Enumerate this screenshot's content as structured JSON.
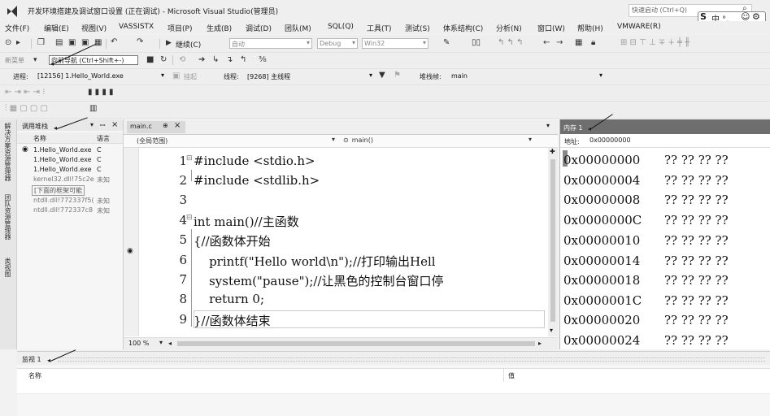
{
  "window": {
    "title": "开发环境搭建及调试窗口设置 (正在调试) - Microsoft Visual Studio(管理员)",
    "quick_launch": "快速启动 (Ctrl+Q)",
    "ime": "中 °,"
  },
  "menu": [
    "文件(F)",
    "编辑(E)",
    "视图(V)",
    "VASSISTX",
    "项目(P)",
    "生成(B)",
    "调试(D)",
    "团队(M)",
    "SQL(Q)",
    "工具(T)",
    "测试(S)",
    "体系结构(C)",
    "分析(N)",
    "窗口(W)",
    "帮助(H)",
    "VMWARE(R)"
  ],
  "toolbar1": {
    "continue_label": "继续(C)",
    "auto_combo": "自动",
    "config_combo": "Debug",
    "platform_combo": "Win32"
  },
  "toolbar2": {
    "new_menu": "新菜单",
    "tooltip": "向前导航 (Ctrl+Shift+-)"
  },
  "toolbar3": {
    "process_label": "进程:",
    "process_value": "[12156] 1.Hello_World.exe",
    "suspend_label": "挂起",
    "thread_label": "线程:",
    "thread_value": "[9268] 主线程",
    "stack_label": "堆栈帧:",
    "stack_value": "main"
  },
  "call_stack": {
    "title": "调用堆栈",
    "col_name": "名称",
    "col_lang": "语言",
    "rows": [
      {
        "name": "1.Hello_World.exe",
        "lang": "C"
      },
      {
        "name": "1.Hello_World.exe",
        "lang": "C"
      },
      {
        "name": "1.Hello_World.exe",
        "lang": "C"
      },
      {
        "name": "kernel32.dll!75c2e",
        "lang": "未知"
      },
      {
        "name": "[下面的框架可能",
        "lang": ""
      },
      {
        "name": "ntdll.dll!772337f5(",
        "lang": "未知"
      },
      {
        "name": "ntdll.dll!772337c8",
        "lang": "未知"
      }
    ]
  },
  "side_tabs": [
    "解决方案资源管理器",
    "团队资源管理器",
    "类视图"
  ],
  "editor": {
    "tab": "main.c",
    "scope": "(全局范围)",
    "function": "main()",
    "zoom": "100 %",
    "line_numbers": [
      "1",
      "2",
      "3",
      "4",
      "5",
      "6",
      "7",
      "8",
      "9"
    ],
    "lines": [
      "#include <stdio.h>",
      "#include <stdlib.h>",
      "",
      "int main()//主函数",
      "{//函数体开始",
      "    printf(\"Hello world\\n\");//打印输出Hell",
      "    system(\"pause\");//让黑色的控制台窗口停",
      "    return 0;",
      "}//函数体结束"
    ]
  },
  "memory": {
    "title": "内存 1",
    "address_label": "地址:",
    "address_value": "0x00000000",
    "rows": [
      {
        "addr": "0x00000000",
        "bytes": "?? ?? ?? ??"
      },
      {
        "addr": "0x00000004",
        "bytes": "?? ?? ?? ??"
      },
      {
        "addr": "0x00000008",
        "bytes": "?? ?? ?? ??"
      },
      {
        "addr": "0x0000000C",
        "bytes": "?? ?? ?? ??"
      },
      {
        "addr": "0x00000010",
        "bytes": "?? ?? ?? ??"
      },
      {
        "addr": "0x00000014",
        "bytes": "?? ?? ?? ??"
      },
      {
        "addr": "0x00000018",
        "bytes": "?? ?? ?? ??"
      },
      {
        "addr": "0x0000001C",
        "bytes": "?? ?? ?? ??"
      },
      {
        "addr": "0x00000020",
        "bytes": "?? ?? ?? ??"
      },
      {
        "addr": "0x00000024",
        "bytes": "?? ?? ?? ??"
      }
    ]
  },
  "watch": {
    "title": "监视 1",
    "col_name": "名称",
    "col_value": "值"
  },
  "colors": {
    "memory_header": "#6e6e6e",
    "accent": "#68217a"
  }
}
